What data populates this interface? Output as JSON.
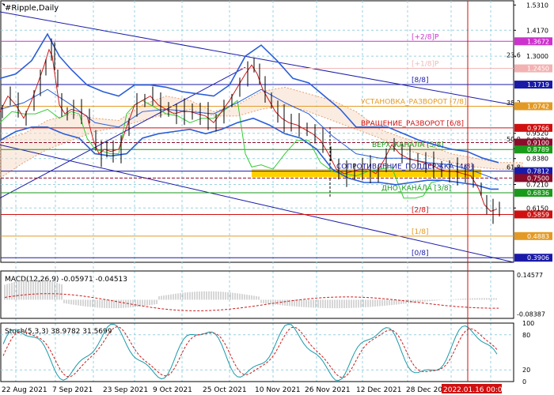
{
  "chart_data": {
    "type": "line",
    "title": "#Ripple,Daily",
    "main": {
      "ylim": [
        0.37,
        1.55
      ],
      "price_ticks": [
        "1.5310",
        "1.4170",
        "1.3000",
        "0.9520",
        "0.9230",
        "0.8830",
        "0.8380",
        "0.7210",
        "0.6150"
      ],
      "x_labels": [
        "22 Aug 2021",
        "7 Sep 2021",
        "23 Sep 2021",
        "9 Oct 2021",
        "25 Oct 2021",
        "10 Nov 2021",
        "26 Nov 2021",
        "12 Dec 2021",
        "28 Dec 2021",
        "2022.01.16 00:00"
      ],
      "levels": [
        {
          "value": 1.3672,
          "label": "1.3672",
          "text": "[+2/8]P",
          "color": "#cc33cc",
          "bg": "#cc33cc"
        },
        {
          "value": 1.245,
          "label": "1.2450",
          "text": "[+1/8]P",
          "color": "#f0b8b8",
          "bg": "#f3b2b2"
        },
        {
          "value": 1.1719,
          "label": "1.1719",
          "text": "[8/8]",
          "color": "#1a1aa8",
          "bg": "#1a1aa8"
        },
        {
          "value": 1.0742,
          "label": "1.0742",
          "text": "УСТАНОВКА_РАЗВОРОТ [7/8]",
          "color": "#e39a24",
          "bg": "#e39a24"
        },
        {
          "value": 0.9766,
          "label": "0.9766",
          "text": "ВРАЩЕНИЕ_РАЗВОРОТ [6/8]",
          "color": "#d01010",
          "bg": "#d01010"
        },
        {
          "value": 0.91,
          "label": "0.9100",
          "text": "",
          "color": "#8a0b2a",
          "bg": "#8a0b2a"
        },
        {
          "value": 0.8789,
          "label": "0.8789",
          "text": "ВЕРХ_КАНАЛА [5/8]",
          "color": "#1a9a1a",
          "bg": "#1a9a1a"
        },
        {
          "value": 0.7812,
          "label": "0.7812",
          "text": "СОПРОТИВЛЕНИЕ_ПОДДЕРЖКА [4/8]",
          "color": "#1a1aa8",
          "bg": "#1a1aa8"
        },
        {
          "value": 0.75,
          "label": "0.7500",
          "text": "",
          "color": "#8a0b2a",
          "bg": "#8a0b2a"
        },
        {
          "value": 0.6836,
          "label": "0.6836",
          "text": "ДНО_КАНАЛА [3/8]",
          "color": "#1a9a1a",
          "bg": "#1a9a1a"
        },
        {
          "value": 0.5859,
          "label": "0.5859",
          "text": "[2/8]",
          "color": "#d01010",
          "bg": "#d01010"
        },
        {
          "value": 0.4883,
          "label": "0.4883",
          "text": "[1/8]",
          "color": "#e39a24",
          "bg": "#e39a24"
        },
        {
          "value": 0.3906,
          "label": "0.3906",
          "text": "[0/8]",
          "color": "#1a1aa8",
          "bg": "#1a1aa8"
        }
      ],
      "fib_labels": [
        {
          "text": "23.6",
          "value": 1.295
        },
        {
          "text": "38.2",
          "value": 1.08
        },
        {
          "text": "50.0",
          "value": 0.916
        },
        {
          "text": "61.8",
          "value": 0.788
        }
      ],
      "close_path": [
        [
          0,
          1.05
        ],
        [
          10,
          1.12
        ],
        [
          20,
          1.08
        ],
        [
          30,
          1.02
        ],
        [
          40,
          1.1
        ],
        [
          48,
          1.18
        ],
        [
          55,
          1.25
        ],
        [
          62,
          1.33
        ],
        [
          66,
          1.3
        ],
        [
          70,
          1.2
        ],
        [
          75,
          1.08
        ],
        [
          82,
          1.04
        ],
        [
          90,
          1.06
        ],
        [
          100,
          1.05
        ],
        [
          110,
          1.03
        ],
        [
          118,
          0.92
        ],
        [
          125,
          0.86
        ],
        [
          132,
          0.88
        ],
        [
          140,
          0.87
        ],
        [
          150,
          0.88
        ],
        [
          160,
          0.98
        ],
        [
          170,
          1.08
        ],
        [
          180,
          1.1
        ],
        [
          190,
          1.12
        ],
        [
          200,
          1.08
        ],
        [
          210,
          1.06
        ],
        [
          220,
          1.04
        ],
        [
          230,
          1.05
        ],
        [
          240,
          1.05
        ],
        [
          250,
          1.04
        ],
        [
          260,
          1.03
        ],
        [
          270,
          1.0
        ],
        [
          280,
          1.05
        ],
        [
          290,
          1.1
        ],
        [
          300,
          1.16
        ],
        [
          310,
          1.22
        ],
        [
          318,
          1.26
        ],
        [
          325,
          1.22
        ],
        [
          332,
          1.15
        ],
        [
          340,
          1.1
        ],
        [
          348,
          1.05
        ],
        [
          356,
          1.02
        ],
        [
          365,
          1.0
        ],
        [
          375,
          0.99
        ],
        [
          385,
          0.97
        ],
        [
          395,
          0.95
        ],
        [
          405,
          0.92
        ],
        [
          415,
          0.86
        ],
        [
          425,
          0.79
        ],
        [
          435,
          0.77
        ],
        [
          445,
          0.78
        ],
        [
          455,
          0.79
        ],
        [
          465,
          0.79
        ],
        [
          475,
          0.77
        ],
        [
          485,
          0.83
        ],
        [
          495,
          0.9
        ],
        [
          505,
          0.86
        ],
        [
          515,
          0.84
        ],
        [
          525,
          0.83
        ],
        [
          535,
          0.82
        ],
        [
          545,
          0.81
        ],
        [
          555,
          0.79
        ],
        [
          565,
          0.78
        ],
        [
          575,
          0.78
        ],
        [
          585,
          0.77
        ],
        [
          595,
          0.76
        ],
        [
          605,
          0.7
        ],
        [
          612,
          0.63
        ],
        [
          620,
          0.6
        ],
        [
          628,
          0.61
        ]
      ],
      "bb_upper_path": [
        [
          0,
          1.2
        ],
        [
          20,
          1.22
        ],
        [
          40,
          1.28
        ],
        [
          60,
          1.4
        ],
        [
          75,
          1.3
        ],
        [
          90,
          1.24
        ],
        [
          110,
          1.17
        ],
        [
          130,
          1.14
        ],
        [
          150,
          1.12
        ],
        [
          170,
          1.17
        ],
        [
          190,
          1.17
        ],
        [
          210,
          1.16
        ],
        [
          230,
          1.14
        ],
        [
          250,
          1.13
        ],
        [
          270,
          1.12
        ],
        [
          290,
          1.17
        ],
        [
          310,
          1.3
        ],
        [
          330,
          1.35
        ],
        [
          350,
          1.28
        ],
        [
          370,
          1.2
        ],
        [
          390,
          1.18
        ],
        [
          410,
          1.12
        ],
        [
          430,
          1.06
        ],
        [
          450,
          0.98
        ],
        [
          470,
          0.98
        ],
        [
          490,
          0.98
        ],
        [
          510,
          0.95
        ],
        [
          530,
          0.92
        ],
        [
          550,
          0.9
        ],
        [
          570,
          0.88
        ],
        [
          590,
          0.87
        ],
        [
          610,
          0.84
        ],
        [
          630,
          0.82
        ]
      ],
      "bb_lower_path": [
        [
          0,
          0.92
        ],
        [
          20,
          0.96
        ],
        [
          40,
          0.98
        ],
        [
          60,
          0.98
        ],
        [
          80,
          0.95
        ],
        [
          100,
          0.93
        ],
        [
          120,
          0.86
        ],
        [
          140,
          0.85
        ],
        [
          160,
          0.86
        ],
        [
          180,
          0.93
        ],
        [
          200,
          0.95
        ],
        [
          220,
          0.96
        ],
        [
          240,
          0.97
        ],
        [
          260,
          0.95
        ],
        [
          280,
          0.97
        ],
        [
          300,
          1.0
        ],
        [
          320,
          1.02
        ],
        [
          340,
          0.99
        ],
        [
          360,
          0.95
        ],
        [
          380,
          0.93
        ],
        [
          400,
          0.88
        ],
        [
          420,
          0.79
        ],
        [
          440,
          0.75
        ],
        [
          460,
          0.73
        ],
        [
          480,
          0.73
        ],
        [
          500,
          0.72
        ],
        [
          520,
          0.73
        ],
        [
          540,
          0.74
        ],
        [
          560,
          0.74
        ],
        [
          580,
          0.73
        ],
        [
          600,
          0.72
        ],
        [
          620,
          0.7
        ],
        [
          630,
          0.7
        ]
      ],
      "bb_mid_path": [
        [
          0,
          1.06
        ],
        [
          30,
          1.09
        ],
        [
          60,
          1.15
        ],
        [
          90,
          1.08
        ],
        [
          120,
          1.0
        ],
        [
          150,
          0.98
        ],
        [
          180,
          1.05
        ],
        [
          210,
          1.06
        ],
        [
          240,
          1.05
        ],
        [
          270,
          1.04
        ],
        [
          300,
          1.09
        ],
        [
          330,
          1.15
        ],
        [
          360,
          1.09
        ],
        [
          390,
          1.04
        ],
        [
          420,
          0.94
        ],
        [
          450,
          0.86
        ],
        [
          480,
          0.84
        ],
        [
          510,
          0.84
        ],
        [
          540,
          0.82
        ],
        [
          570,
          0.81
        ],
        [
          600,
          0.78
        ],
        [
          630,
          0.74
        ]
      ],
      "green_path": [
        [
          0,
          1.0
        ],
        [
          15,
          1.05
        ],
        [
          30,
          1.04
        ],
        [
          45,
          1.04
        ],
        [
          60,
          1.06
        ],
        [
          75,
          1.02
        ],
        [
          90,
          1.05
        ],
        [
          100,
          1.04
        ],
        [
          110,
          0.93
        ],
        [
          120,
          0.88
        ],
        [
          130,
          0.87
        ],
        [
          140,
          0.86
        ],
        [
          150,
          0.86
        ],
        [
          160,
          1.04
        ],
        [
          170,
          1.08
        ],
        [
          180,
          1.1
        ],
        [
          195,
          1.07
        ],
        [
          210,
          1.04
        ],
        [
          225,
          1.03
        ],
        [
          240,
          1.0
        ],
        [
          255,
          1.02
        ],
        [
          270,
          1.02
        ],
        [
          285,
          1.06
        ],
        [
          300,
          1.1
        ],
        [
          310,
          0.86
        ],
        [
          318,
          0.8
        ],
        [
          330,
          0.81
        ],
        [
          345,
          0.79
        ],
        [
          360,
          0.86
        ],
        [
          375,
          0.92
        ],
        [
          390,
          0.92
        ],
        [
          405,
          0.82
        ],
        [
          420,
          0.78
        ],
        [
          435,
          0.77
        ],
        [
          450,
          0.76
        ],
        [
          465,
          0.78
        ],
        [
          480,
          0.79
        ],
        [
          495,
          0.8
        ],
        [
          510,
          0.66
        ],
        [
          525,
          0.66
        ],
        [
          535,
          0.67
        ],
        [
          545,
          0.73
        ],
        [
          560,
          0.74
        ]
      ],
      "ichimoku_cloud_top": [
        [
          0,
          0.92
        ],
        [
          30,
          0.95
        ],
        [
          60,
          1.01
        ],
        [
          90,
          1.04
        ],
        [
          120,
          1.02
        ],
        [
          150,
          1.01
        ],
        [
          180,
          1.08
        ],
        [
          210,
          1.12
        ],
        [
          240,
          1.1
        ],
        [
          270,
          1.05
        ],
        [
          300,
          1.08
        ],
        [
          330,
          1.14
        ],
        [
          360,
          1.16
        ],
        [
          390,
          1.13
        ],
        [
          420,
          1.1
        ],
        [
          450,
          1.05
        ],
        [
          480,
          0.97
        ],
        [
          510,
          0.93
        ],
        [
          540,
          0.9
        ],
        [
          570,
          0.86
        ],
        [
          600,
          0.84
        ],
        [
          630,
          0.82
        ],
        [
          660,
          0.82
        ]
      ],
      "ichimoku_cloud_bot": [
        [
          0,
          0.75
        ],
        [
          30,
          0.82
        ],
        [
          60,
          0.88
        ],
        [
          90,
          0.92
        ],
        [
          120,
          0.96
        ],
        [
          150,
          0.98
        ],
        [
          180,
          1.01
        ],
        [
          210,
          1.04
        ],
        [
          240,
          1.06
        ],
        [
          270,
          1.03
        ],
        [
          300,
          1.03
        ],
        [
          330,
          1.06
        ],
        [
          360,
          1.08
        ],
        [
          390,
          1.05
        ],
        [
          420,
          1.01
        ],
        [
          450,
          0.97
        ],
        [
          480,
          0.93
        ],
        [
          510,
          0.88
        ],
        [
          540,
          0.85
        ],
        [
          570,
          0.82
        ],
        [
          600,
          0.8
        ],
        [
          630,
          0.79
        ],
        [
          660,
          0.79
        ]
      ]
    },
    "macd": {
      "label": "MACD(12,26,9) -0.05971 -0.04513",
      "ticks": [
        "0.14577",
        "-0.08387"
      ],
      "ylim": [
        -0.11,
        0.17
      ]
    },
    "stoch": {
      "label": "Stoch(5,3,3) 38.9782 31.5699",
      "ticks": [
        "100",
        "80",
        "20",
        "0"
      ],
      "ylim": [
        0,
        100
      ]
    }
  }
}
